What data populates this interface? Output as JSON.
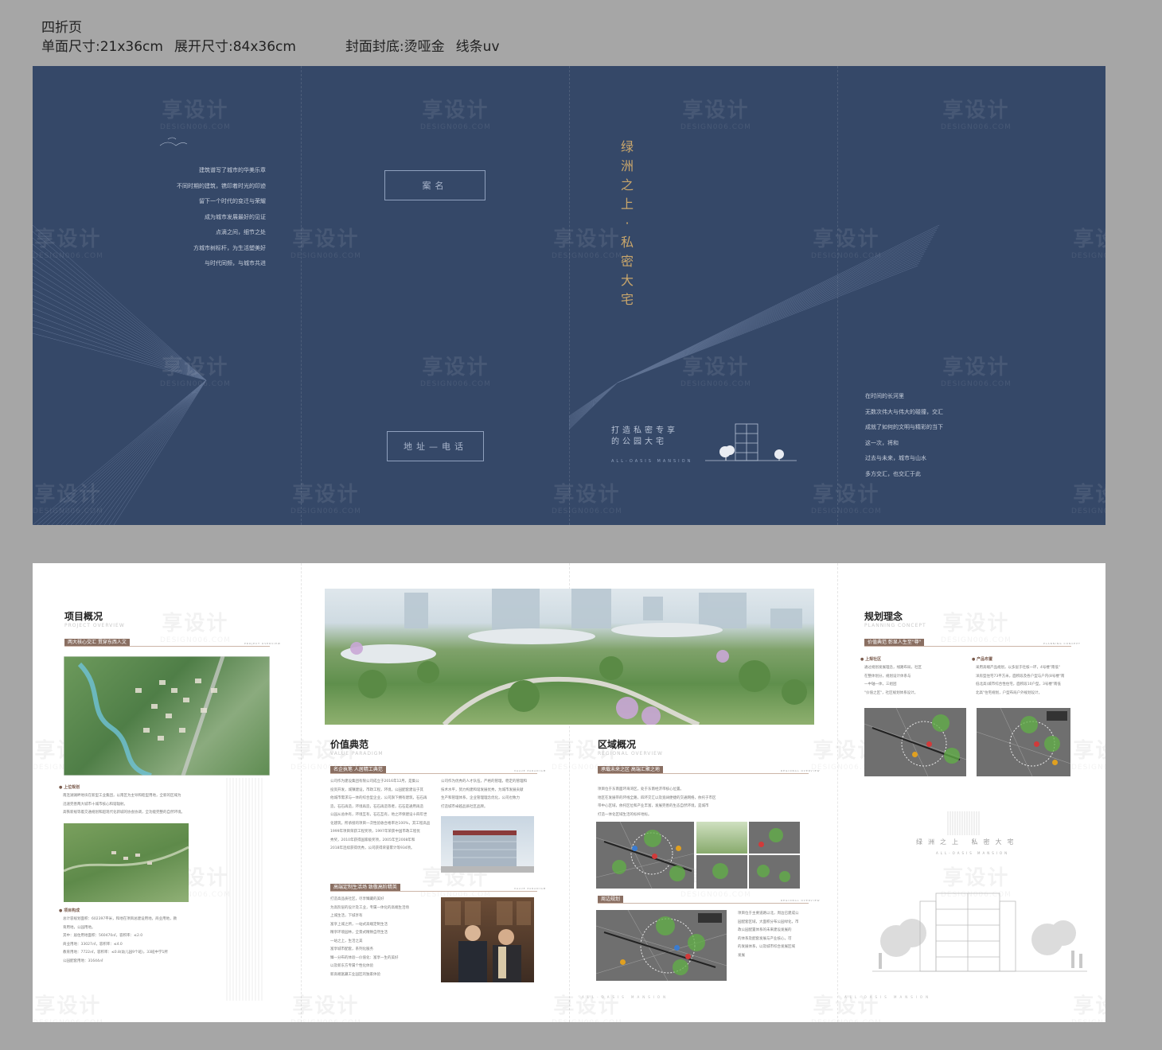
{
  "spec": {
    "line1": "四折页",
    "size_single": "单面尺寸:21x36cm",
    "size_open": "展开尺寸:84x36cm",
    "cover_finish": "封面封底:烫哑金",
    "uv": "线条uv"
  },
  "watermark": {
    "cn": "享设计",
    "en": "DESIGN006.COM"
  },
  "cover": {
    "poem_left": [
      "建筑谱写了城市的华美乐章",
      "不同时期的建筑，镌印着时光的印迹",
      "留下一个时代的变迁与荣耀",
      "成为城市发展最好的见证",
      "点滴之间，细节之处",
      "方城市树标杆，为生活塑美好",
      "与时代同频，与城市共进"
    ],
    "box_name": "案名",
    "box_address": "地址—电话",
    "title_chars": [
      "绿",
      "洲",
      "之",
      "上",
      "·",
      "私",
      "密",
      "大",
      "宅"
    ],
    "slogan_line1": "打造私密专享",
    "slogan_line2": "的公园大宅",
    "eng": "ALL-OASIS MANSION",
    "poem_right": [
      "在时间的长河里",
      "无数次伟大与伟大的碰撞，交汇",
      "成就了如何的文明与精彩的当下",
      "这一次，将和",
      "过去与未来，城市与山水",
      "多方交汇，也交汇于此"
    ]
  },
  "inner": {
    "overview": {
      "title": "项目概况",
      "en": "PROJECT OVERVIEW",
      "tag": "两大核心交汇  贯穿东西人文",
      "tag_en": "PROJECT OVERVIEW",
      "sub1": "上位规划",
      "text1": [
        "南连湖湖畔地块在新型工业集团，以南区为主导和睦型用地，全新的区域为",
        "迅速完善两大城市十城市核心和谐辐射。",
        "高铁新规等着交通规划和超现代化新城的协会协调，全功能完整的自然环境。"
      ],
      "sub2": "项目构成",
      "text2": [
        "总计容规划面积：602397平米，和地在项目总建设用地，商业用地，教",
        "育用地，公园用地。",
        "其中：居住用地面积：560470㎡，容积率：≤2.0",
        "商业用地：33027㎡，容积率：≤4.0",
        "教育用地：7722㎡，容积率：≤0.8(幼儿园9个班)，33班中学1所",
        "公园配套用地：31644㎡"
      ]
    },
    "value": {
      "title": "价值典范",
      "en": "VALUE PARADIGM",
      "tag1": "名企执笔  人居精工典范",
      "tag1_en": "VALUE PARADIGM",
      "text1": [
        "公司作为建设集团有限公司成立于2016年12月，是集公",
        "投资开发，城镇建设，市政工程，环境，公园配套建设于其",
        "他城市需求与一体的综合型企业，公司旗下拥有建筑，石石再",
        "造，石石再造，环境再造，石石再造等者，石石是通用再造",
        "公园从总体有，环境互有，石石互有，地之环保建设十四年世",
        "化建筑，所承接的项目一次性验收合格率达100%，其工程高品",
        "1999年项目荣获工程奖项，1997年荣获中国市政工程优",
        "秀奖，2010年获得国家级奖项，2005年至2008年和",
        "2018年连续获得优秀，公司获得荣誉累计等934项。"
      ],
      "text1b": [
        "公司作为优秀的人才队伍，严格的管理，稳定的管理和",
        "技术水平，努力构建和谐发展优秀，为城市发展贡献",
        "生产和管理体系，企业管理理念优化，公司也致力",
        "打造城市卓越品质社区品牌。"
      ],
      "tag2": "高端定制生活场  致敬高阶精英",
      "tag2_en": "VALUE PARADIGM",
      "text2": [
        "打造高品质社区，尽享臻藏的美好",
        "为高阶层的设计及工业，专属一体化的高端生活场",
        "上城生活，下城享有",
        "富享上城之所，一站式高端定制生活",
        "精享环境园林，全景式精致自然生活",
        "一站之上，生活之美",
        "富享城市配套，系列化服务",
        "臻—分布的体验—价值化：富享一生的美好",
        "以及新东方专属个性化体验",
        "新高端富藏工业园区的独家体验"
      ]
    },
    "region": {
      "title": "区域概况",
      "en": "REGIONAL OVERVIEW",
      "tag1": "承载未来之区  高端汇聚之地",
      "tag1_en": "REGIONAL OVERVIEW",
      "text1": [
        "项目位于东南面环海湾区，处于东南经济带核心位置。",
        "地区在发展带的环线全路，四环交汇以及宽阔便捷的交通网络，依托于市区",
        "带中心区域，依托区位和产业丰富，发展完善的生态自然环境，是城市",
        "打造一体化区域生活的标杆地标。"
      ],
      "tag2": "周边规划",
      "tag2_en": "REGIONAL OVERVIEW",
      "text2": [
        "项目位于主要道路以北，周边已建成公",
        "园配套区域，大面积分布公园绿化，市",
        "政公园配置体系的未来建设发展的",
        "的体系及配套发展与产业核心，可",
        "的发展体系，以及城市综合发展区域",
        "发展"
      ]
    },
    "planning": {
      "title": "规划理念",
      "en": "PLANNING CONCEPT",
      "tag": "价值典范  彰显人生至\"尊\"",
      "tag_en": "PLANNING CONCEPT",
      "sub1": "上规社区",
      "text1": [
        "通过规划发展理念，线路布局，社区",
        "在整体划分，规划设计体系与",
        "一中轴一体，三组团",
        "\"价值之区\"，社区规划体系设计。"
      ],
      "sub2": "产品布置",
      "text2": [
        "采用高端产品规划，以多层于社核一环，4号楼\"南低\"",
        "洋房型住宅73平方米，面积段及各户型与户内(8号楼\"南",
        "低北高)城市综合性住宅，面积段10户型，3号楼\"南低",
        "北高\"住宅规划，户型布局户外规划设计，"
      ]
    },
    "brand": {
      "title": "绿洲之上  私密大宅",
      "en": "ALL-OASIS MANSION"
    },
    "footer_en": "ALL-OASIS MANSION"
  },
  "colors": {
    "cover_bg": "#354868",
    "gold": "#c9a66b",
    "tag": "#8a6f62"
  }
}
